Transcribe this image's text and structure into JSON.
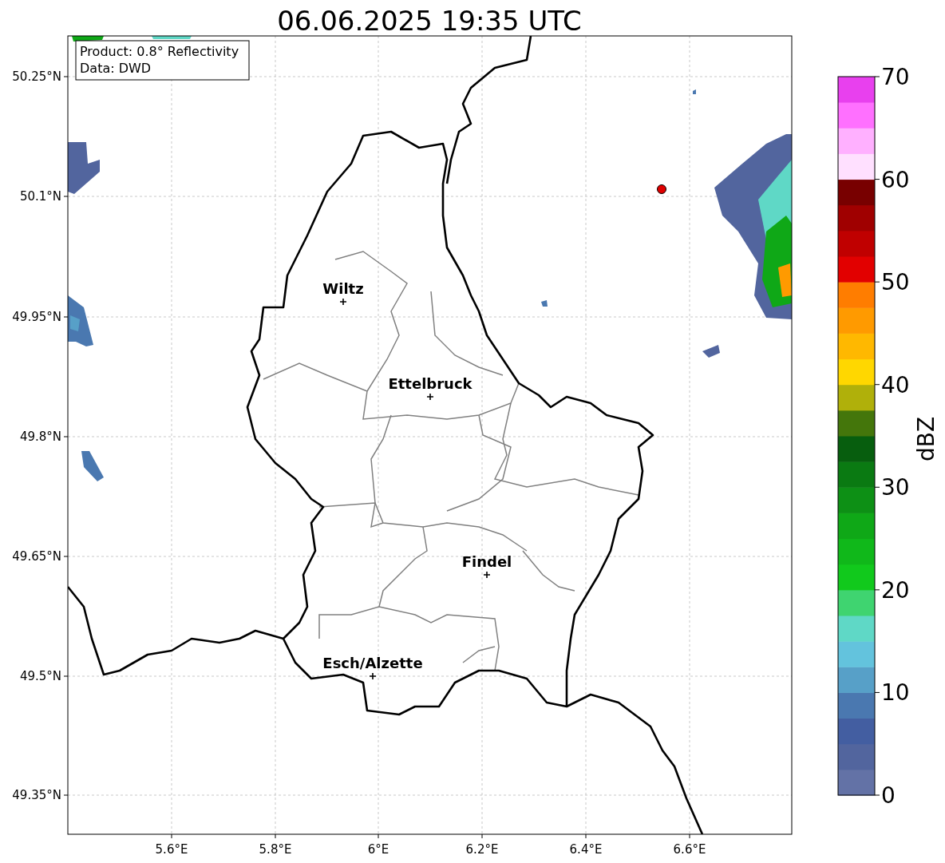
{
  "title": "06.06.2025 19:35 UTC",
  "info_box": [
    "Product: 0.8° Reflectivity",
    "Data: DWD"
  ],
  "x_axis": {
    "ticks": [
      "5.6°E",
      "5.8°E",
      "6°E",
      "6.2°E",
      "6.4°E",
      "6.6°E"
    ]
  },
  "y_axis": {
    "ticks": [
      "50.25°N",
      "50.1°N",
      "49.95°N",
      "49.8°N",
      "49.65°N",
      "49.5°N",
      "49.35°N"
    ]
  },
  "cities": [
    {
      "name": "Wiltz"
    },
    {
      "name": "Ettelbruck"
    },
    {
      "name": "Findel"
    },
    {
      "name": "Esch/Alzette"
    }
  ],
  "colorbar": {
    "label": "dBZ",
    "ticks": [
      "70",
      "60",
      "50",
      "40",
      "30",
      "20",
      "10",
      "0"
    ],
    "bins": [
      {
        "color": "#6372a6"
      },
      {
        "color": "#52659e"
      },
      {
        "color": "#435ea1"
      },
      {
        "color": "#4a78b0"
      },
      {
        "color": "#57a0c8"
      },
      {
        "color": "#63c3dd"
      },
      {
        "color": "#5fd8c6"
      },
      {
        "color": "#3fd470"
      },
      {
        "color": "#11c91c"
      },
      {
        "color": "#10b81a"
      },
      {
        "color": "#0fa817"
      },
      {
        "color": "#0d9015"
      },
      {
        "color": "#0a7a12"
      },
      {
        "color": "#075e0e"
      },
      {
        "color": "#44760b"
      },
      {
        "color": "#b0b00a"
      },
      {
        "color": "#ffd700"
      },
      {
        "color": "#ffb800"
      },
      {
        "color": "#ff9a00"
      },
      {
        "color": "#ff7d00"
      },
      {
        "color": "#e20000"
      },
      {
        "color": "#c00000"
      },
      {
        "color": "#a00000"
      },
      {
        "color": "#780000"
      },
      {
        "color": "#ffe0ff"
      },
      {
        "color": "#ffb0ff"
      },
      {
        "color": "#ff70ff"
      },
      {
        "color": "#e840ee"
      }
    ]
  }
}
